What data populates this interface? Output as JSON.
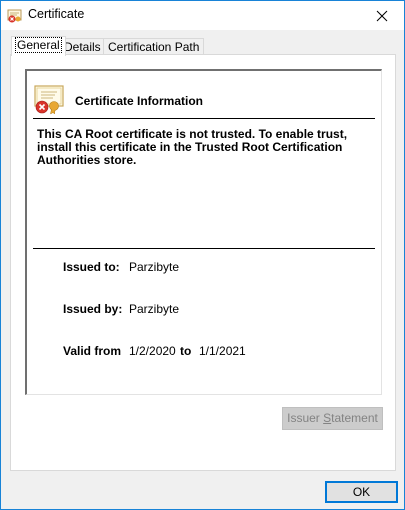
{
  "window": {
    "title": "Certificate"
  },
  "tabs": [
    {
      "label": "General"
    },
    {
      "label": "Details"
    },
    {
      "label": "Certification Path"
    }
  ],
  "general": {
    "heading": "Certificate Information",
    "warning": "This CA Root certificate is not trusted. To enable trust, install this certificate in the Trusted Root Certification Authorities store.",
    "issued_to_label": "Issued to:",
    "issued_to": "Parzibyte",
    "issued_by_label": "Issued by:",
    "issued_by": "Parzibyte",
    "valid_from_label": "Valid from",
    "valid_from": "1/2/2020",
    "valid_to_label": "to",
    "valid_to": "1/1/2021",
    "issuer_statement_prefix": "Issuer ",
    "issuer_statement_accel": "S",
    "issuer_statement_suffix": "tatement"
  },
  "footer": {
    "ok_label": "OK"
  },
  "icons": {
    "app": "certificate-error-icon",
    "close": "close-icon",
    "cert": "certificate-untrusted-icon"
  }
}
